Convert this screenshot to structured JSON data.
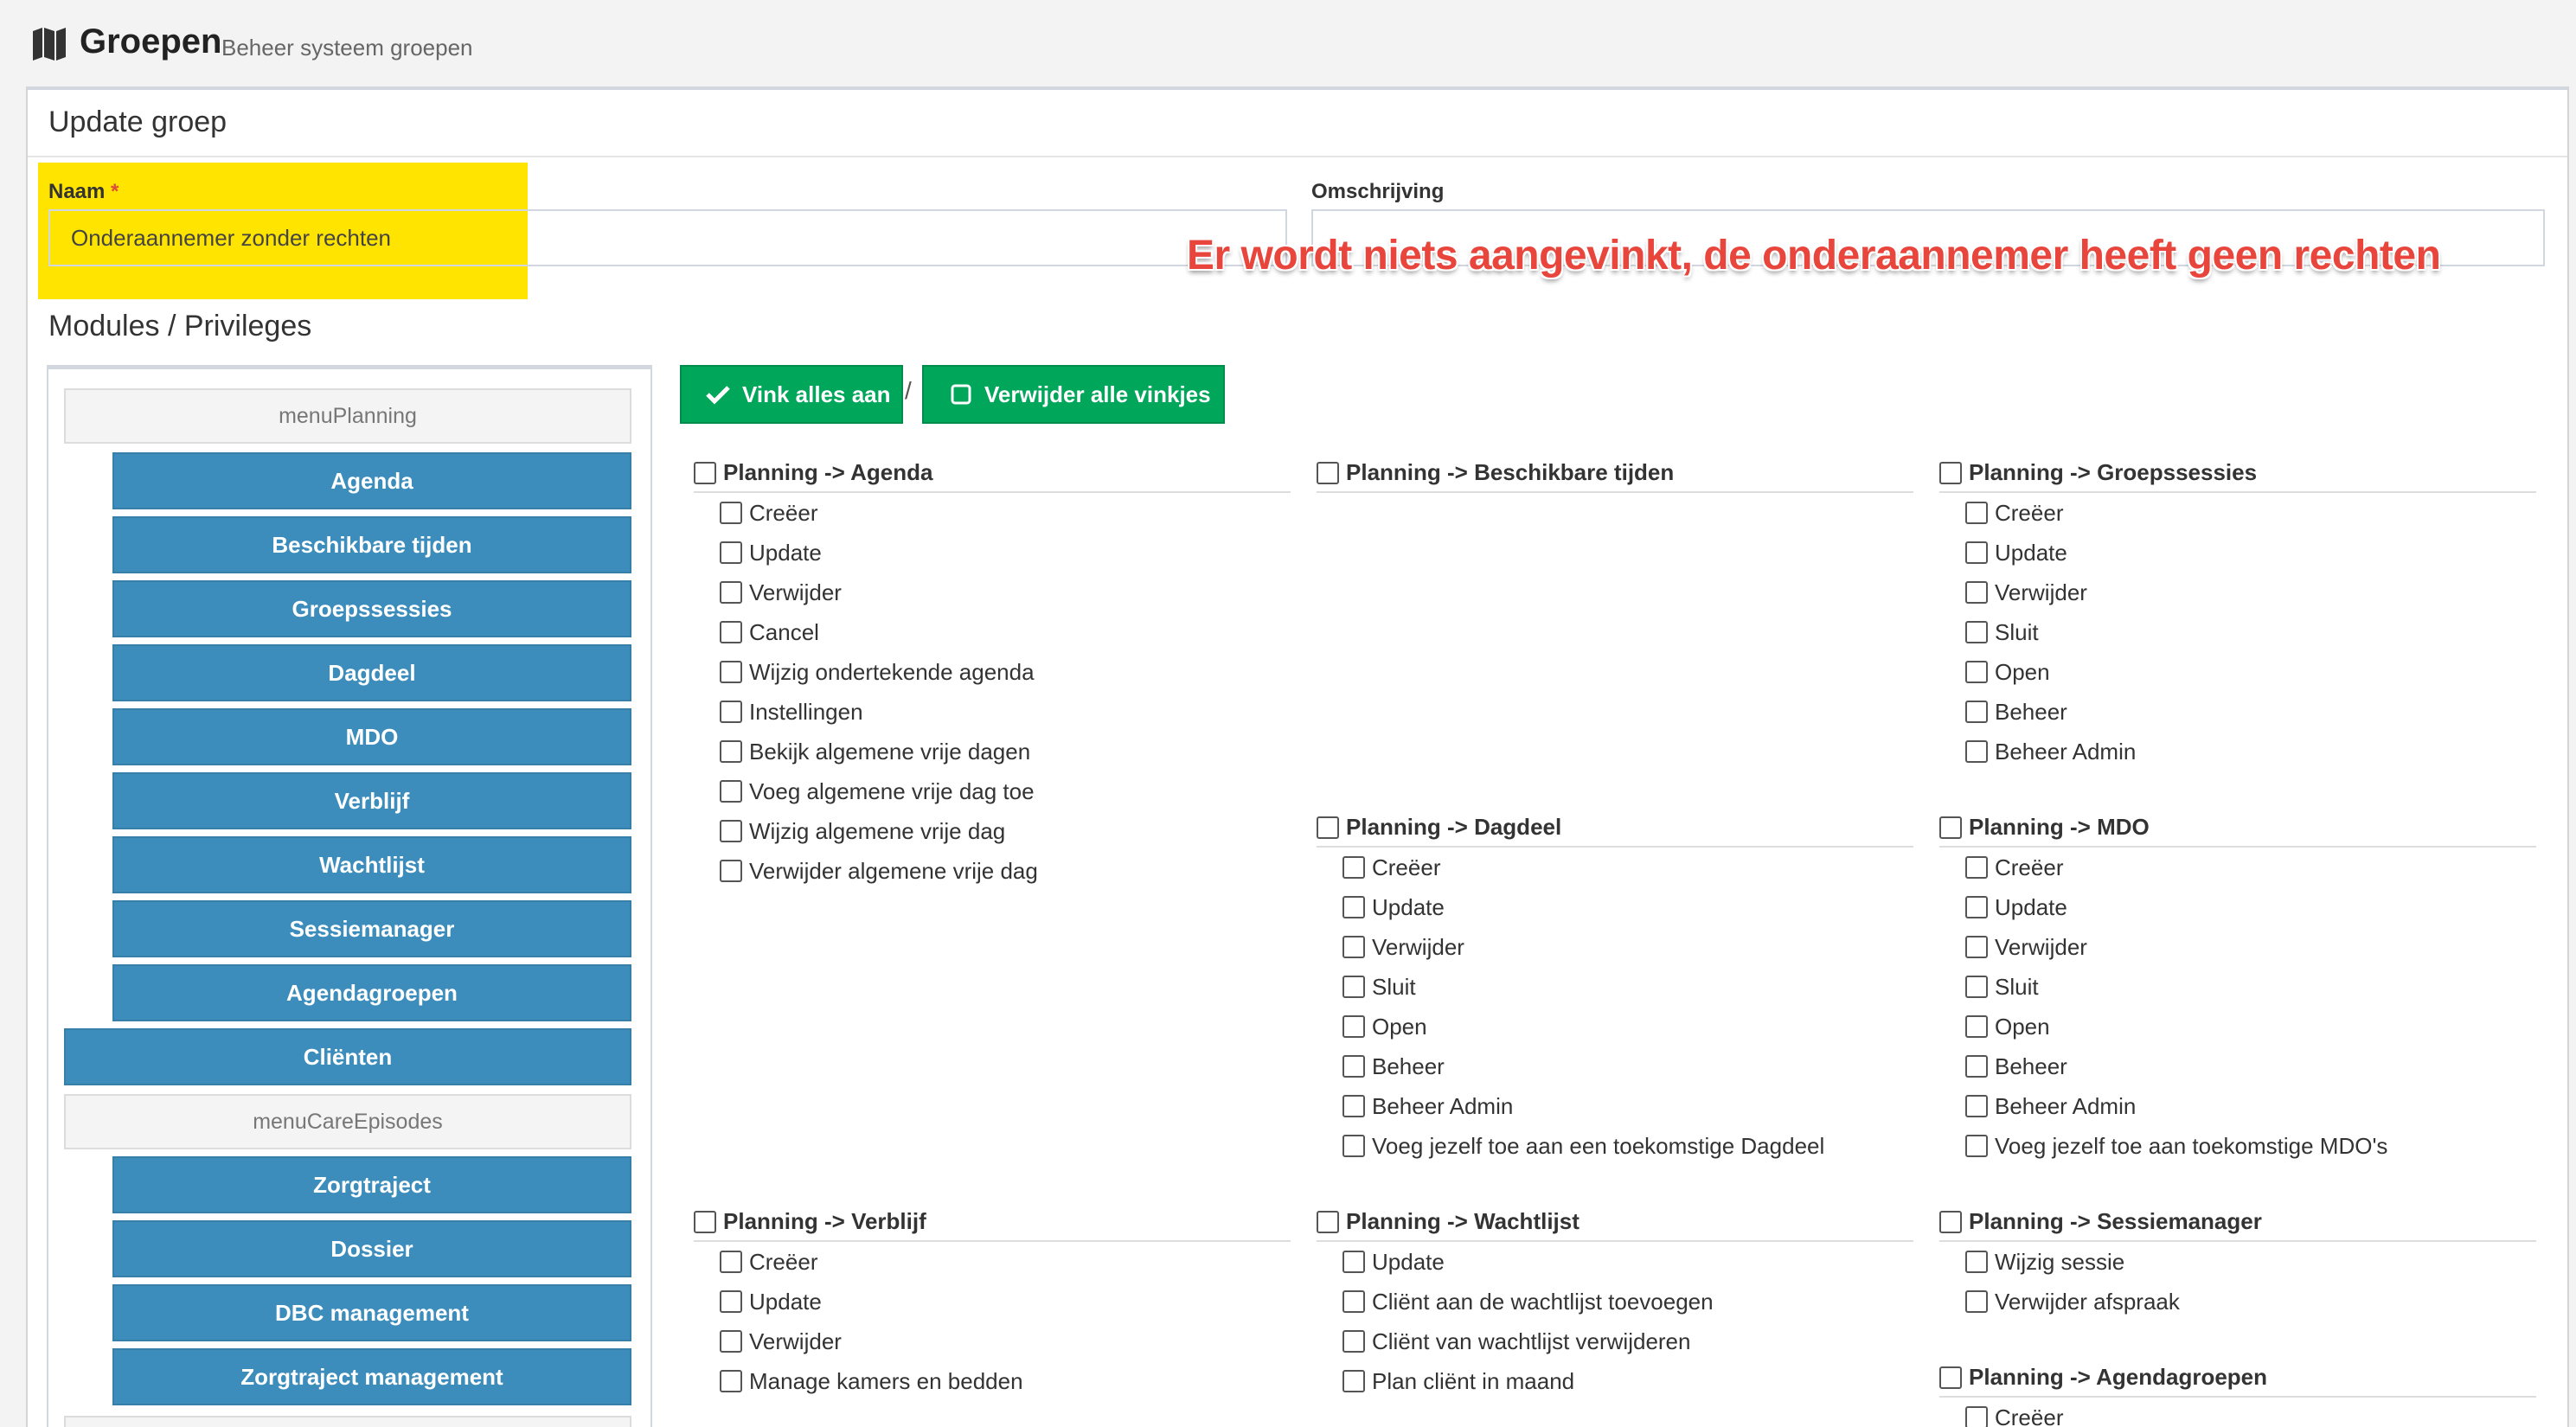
{
  "header": {
    "title": "Groepen",
    "subtitle": "Beheer systeem groepen"
  },
  "panel": {
    "title": "Update groep"
  },
  "form": {
    "name_label": "Naam",
    "name_required": "*",
    "name_value": "Onderaannemer zonder rechten",
    "description_label": "Omschrijving",
    "description_value": ""
  },
  "annotation": "Er wordt niets aangevinkt, de onderaannemer heeft geen rechten",
  "section_title": "Modules / Privileges",
  "sidebar": {
    "header_1": "menuPlanning",
    "items_1": [
      "Agenda",
      "Beschikbare tijden",
      "Groepssessies",
      "Dagdeel",
      "MDO",
      "Verblijf",
      "Wachtlijst",
      "Sessiemanager",
      "Agendagroepen"
    ],
    "top_item": "Cliënten",
    "header_2": "menuCareEpisodes",
    "items_2": [
      "Zorgtraject",
      "Dossier",
      "DBC management",
      "Zorgtraject management"
    ]
  },
  "actions": {
    "check_all": "Vink alles aan",
    "separator": "/",
    "uncheck_all": "Verwijder alle vinkjes"
  },
  "groups": [
    {
      "title": "Planning -> Agenda",
      "perms": [
        "Creëer",
        "Update",
        "Verwijder",
        "Cancel",
        "Wijzig ondertekende agenda",
        "Instellingen",
        "Bekijk algemene vrije dagen",
        "Voeg algemene vrije dag toe",
        "Wijzig algemene vrije dag",
        "Verwijder algemene vrije dag"
      ]
    },
    {
      "title": "Planning -> Beschikbare tijden",
      "perms": []
    },
    {
      "title": "Planning -> Groepssessies",
      "perms": [
        "Creëer",
        "Update",
        "Verwijder",
        "Sluit",
        "Open",
        "Beheer",
        "Beheer Admin"
      ]
    },
    {
      "title": "Planning -> Dagdeel",
      "perms": [
        "Creëer",
        "Update",
        "Verwijder",
        "Sluit",
        "Open",
        "Beheer",
        "Beheer Admin",
        "Voeg jezelf toe aan een toekomstige Dagdeel"
      ]
    },
    {
      "title": "Planning -> MDO",
      "perms": [
        "Creëer",
        "Update",
        "Verwijder",
        "Sluit",
        "Open",
        "Beheer",
        "Beheer Admin",
        "Voeg jezelf toe aan toekomstige MDO's"
      ]
    },
    {
      "title": "Planning -> Verblijf",
      "perms": [
        "Creëer",
        "Update",
        "Verwijder",
        "Manage kamers en bedden"
      ]
    },
    {
      "title": "Planning -> Wachtlijst",
      "perms": [
        "Update",
        "Cliënt aan de wachtlijst toevoegen",
        "Cliënt van wachtlijst verwijderen",
        "Plan cliënt in maand"
      ]
    },
    {
      "title": "Planning -> Sessiemanager",
      "perms": [
        "Wijzig sessie",
        "Verwijder afspraak"
      ]
    },
    {
      "title": "Planning -> Agendagroepen",
      "perms": [
        "Creëer"
      ]
    }
  ]
}
